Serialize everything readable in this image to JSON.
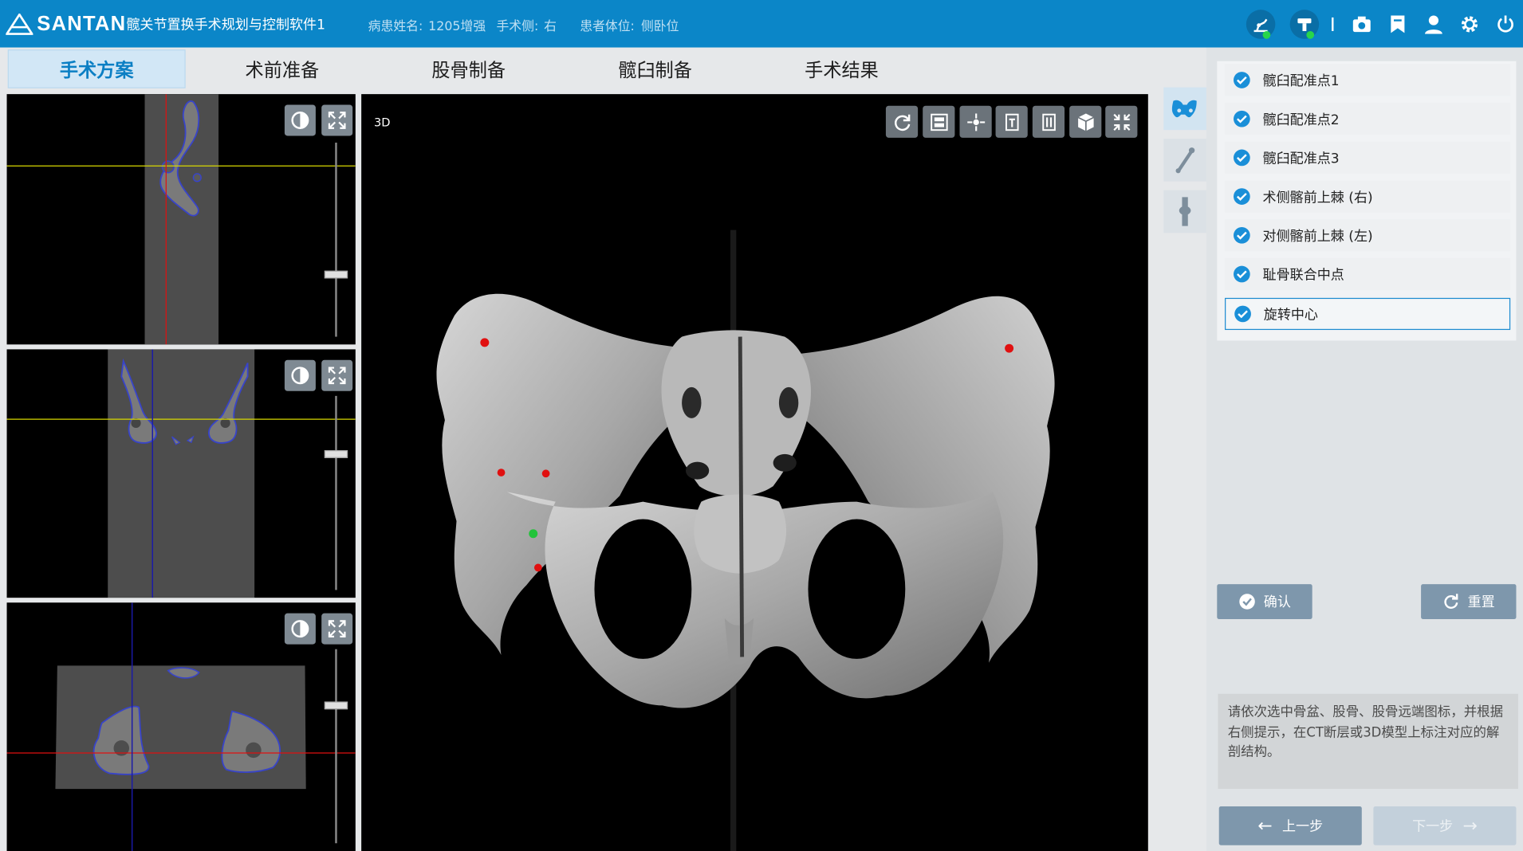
{
  "app": {
    "brand": "SANTAN",
    "title": "髋关节置换手术规划与控制软件1",
    "patient_name_label": "病患姓名:",
    "patient_name": "1205增强",
    "surgery_side_label": "手术侧:",
    "surgery_side": "右",
    "patient_position_label": "患者体位:",
    "patient_position": "侧卧位"
  },
  "top_icons": [
    "robot-arm-icon",
    "tracker-icon",
    "camera-icon",
    "bookmark-icon",
    "user-icon",
    "gear-icon",
    "power-icon"
  ],
  "tabs": [
    {
      "label": "手术方案",
      "active": true
    },
    {
      "label": "术前准备",
      "active": false
    },
    {
      "label": "股骨制备",
      "active": false
    },
    {
      "label": "髋臼制备",
      "active": false
    },
    {
      "label": "手术结果",
      "active": false
    }
  ],
  "viewer3d": {
    "label": "3D",
    "tools": [
      "rotate-icon",
      "3d-ct-icon",
      "center-icon",
      "pelvis-view-icon",
      "femur-view-icon",
      "cube-icon",
      "collapse-icon"
    ]
  },
  "slice_controls": {
    "contrast_icon": "contrast-icon",
    "expand_icon": "expand-icon"
  },
  "side_tabs": [
    "pelvis-icon",
    "femur-icon",
    "distal-femur-icon"
  ],
  "checklist": [
    {
      "label": "髋臼配准点1",
      "checked": true,
      "selected": false
    },
    {
      "label": "髋臼配准点2",
      "checked": true,
      "selected": false
    },
    {
      "label": "髋臼配准点3",
      "checked": true,
      "selected": false
    },
    {
      "label": "术侧髂前上棘 (右)",
      "checked": true,
      "selected": false
    },
    {
      "label": "对侧髂前上棘 (左)",
      "checked": true,
      "selected": false
    },
    {
      "label": "耻骨联合中点",
      "checked": true,
      "selected": false
    },
    {
      "label": "旋转中心",
      "checked": true,
      "selected": true
    }
  ],
  "actions": {
    "confirm": "确认",
    "reset": "重置",
    "prev": "上一步",
    "next": "下一步"
  },
  "hint": "请依次选中骨盆、股骨、股骨远端图标，并根据右侧提示，在CT断层或3D模型上标注对应的解剖结构。",
  "colors": {
    "topbar": "#0b86c8",
    "accent": "#1a8fd8",
    "landmark": "#e01010",
    "rotation_center": "#22c33a"
  }
}
